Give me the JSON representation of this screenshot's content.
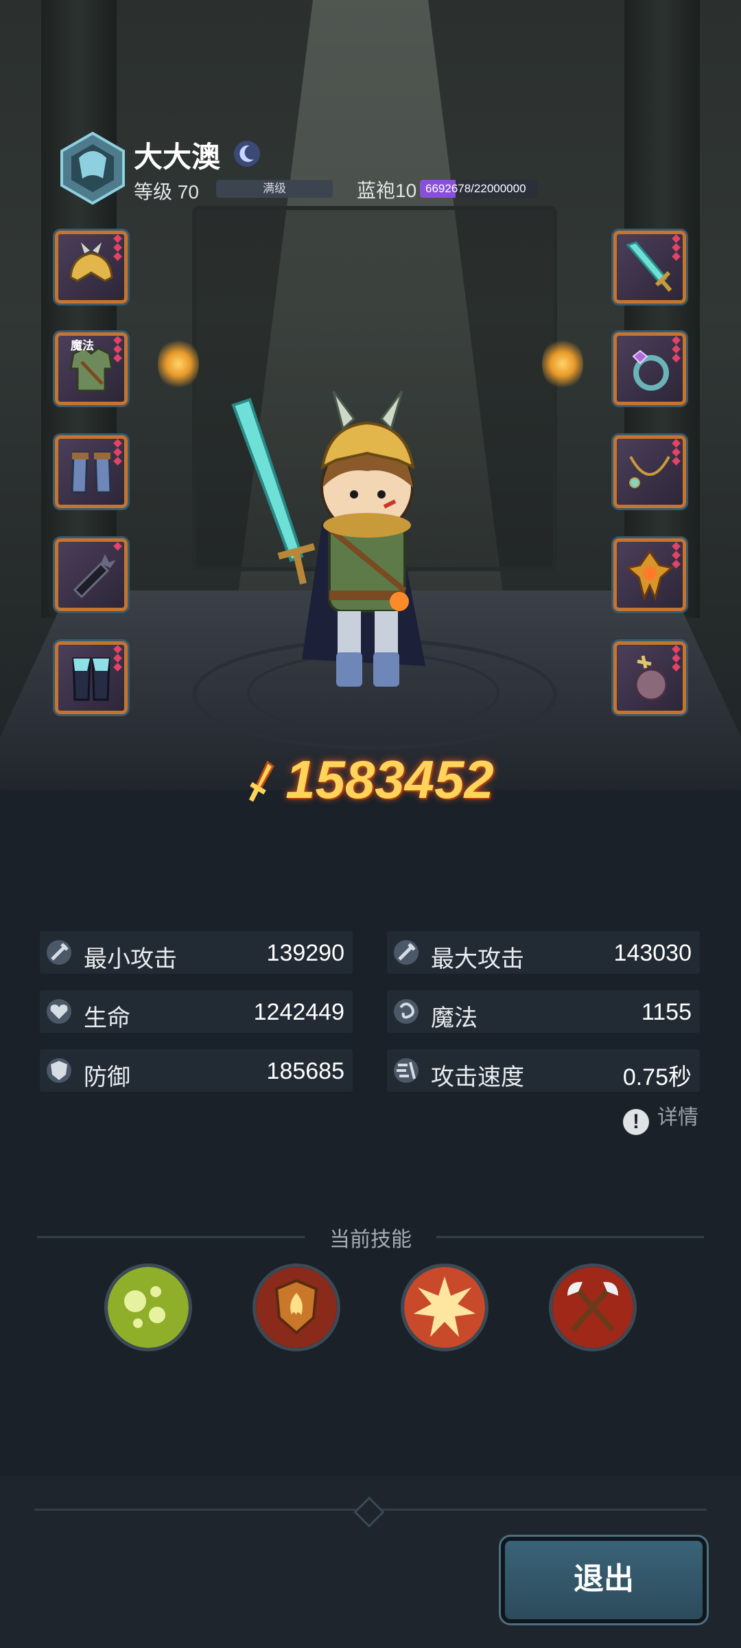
{
  "player": {
    "name": "大大澳",
    "level_label": "等级 70",
    "level_status": "满级",
    "rank_label": "蓝袍10",
    "rank_progress_text": "6692678/22000000",
    "rank_progress_fraction": 0.304
  },
  "equipment": {
    "left": [
      "helmet-icon",
      "armor-icon",
      "boots-icon",
      "bracer-icon",
      "pants-icon"
    ],
    "right": [
      "sword-icon",
      "ring-icon",
      "necklace-icon",
      "amulet-icon",
      "orb-icon"
    ],
    "armor_tag": "魔法"
  },
  "power": "1583452",
  "stats": {
    "min_attack": {
      "label": "最小攻击",
      "value": "139290"
    },
    "max_attack": {
      "label": "最大攻击",
      "value": "143030"
    },
    "hp": {
      "label": "生命",
      "value": "1242449"
    },
    "magic": {
      "label": "魔法",
      "value": "1155"
    },
    "defense": {
      "label": "防御",
      "value": "185685"
    },
    "attack_speed": {
      "label": "攻击速度",
      "value": "0.75秒"
    }
  },
  "details_label": "详情",
  "skills": {
    "title": "当前技能",
    "icons": [
      "poison-orbs-icon",
      "flame-shield-icon",
      "explosion-icon",
      "crossed-axes-icon"
    ]
  },
  "exit_label": "退出",
  "colors": {
    "background": "#1a2129",
    "power_gold": "#ffd45a",
    "slot_border": "#c6742e",
    "rank_bar": "#8a4fd8",
    "exit_button": "#3a6377"
  }
}
